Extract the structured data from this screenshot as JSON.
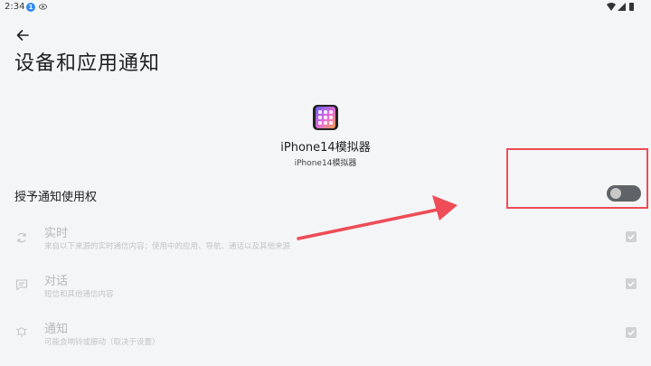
{
  "status_bar": {
    "time": "2:34",
    "badge": "1"
  },
  "header": {
    "title": "设备和应用通知"
  },
  "app": {
    "name": "iPhone14模拟器",
    "package_label": "iPhone14模拟器"
  },
  "permission": {
    "label": "授予通知使用权",
    "enabled": false
  },
  "categories": [
    {
      "title": "实时",
      "description": "来自以下来源的实时通信内容：使用中的应用、导航、通话以及其他来源",
      "icon": "sync-icon",
      "checked": true
    },
    {
      "title": "对话",
      "description": "短信和其他通信内容",
      "icon": "chat-icon",
      "checked": true
    },
    {
      "title": "通知",
      "description": "可能会响铃或振动（取决于设置）",
      "icon": "bell-icon",
      "checked": true
    }
  ],
  "colors": {
    "accent_annotation": "#ee4c56",
    "toggle_off": "#5f6368",
    "background": "#f4f5f7"
  }
}
